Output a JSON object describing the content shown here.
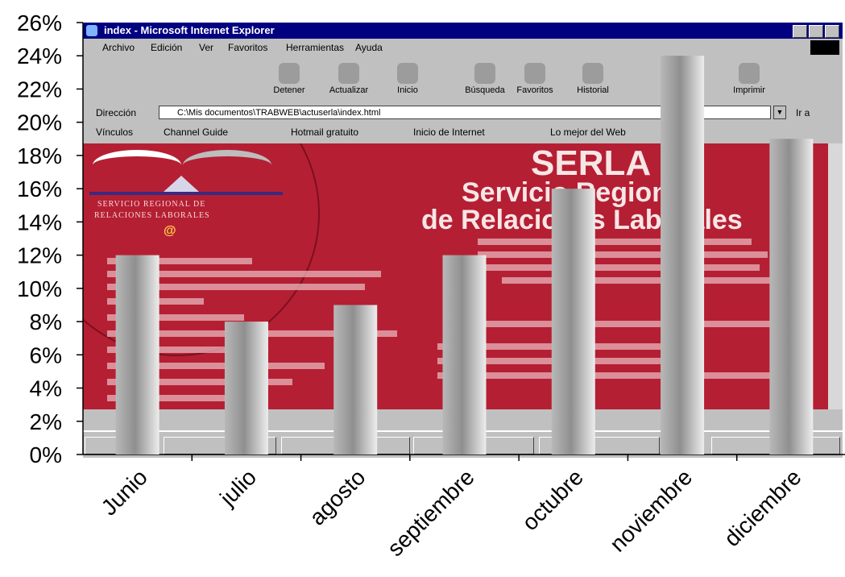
{
  "chart_data": {
    "type": "bar",
    "categories": [
      "Junio",
      "julio",
      "agosto",
      "septiembre",
      "octubre",
      "noviembre",
      "diciembre"
    ],
    "values": [
      12,
      8,
      9,
      12,
      16,
      24,
      19
    ],
    "ylim": [
      0,
      26
    ],
    "yticks": [
      "0%",
      "2%",
      "4%",
      "6%",
      "8%",
      "10%",
      "12%",
      "14%",
      "16%",
      "18%",
      "20%",
      "22%",
      "24%",
      "26%"
    ],
    "title": "",
    "xlabel": "",
    "ylabel": "",
    "grid": false,
    "bar_color": "#9a9a9a"
  },
  "background_screenshot": {
    "window_title": "index - Microsoft Internet Explorer",
    "menu": [
      "Archivo",
      "Edición",
      "Ver",
      "Favoritos",
      "Herramientas",
      "Ayuda"
    ],
    "toolbar": [
      "Detener",
      "Actualizar",
      "Inicio",
      "Búsqueda",
      "Favoritos",
      "Historial",
      "Imprimir"
    ],
    "address_label": "Dirección",
    "address_value": "C:\\Mis documentos\\TRABWEB\\actuserla\\index.html",
    "go_label": "Ir a",
    "links_label": "Vínculos",
    "links": [
      "Channel Guide",
      "Hotmail gratuito",
      "Inicio de Internet",
      "Lo mejor del Web"
    ],
    "site_brand": "SERLA",
    "site_heading_1": "Servicio Regional",
    "site_heading_2": "de Relaciones Laborales",
    "site_logo_line_1": "SERVICIO REGIONAL DE",
    "site_logo_line_2": "RELACIONES LABORALES",
    "site_logo_symbol": "@"
  }
}
